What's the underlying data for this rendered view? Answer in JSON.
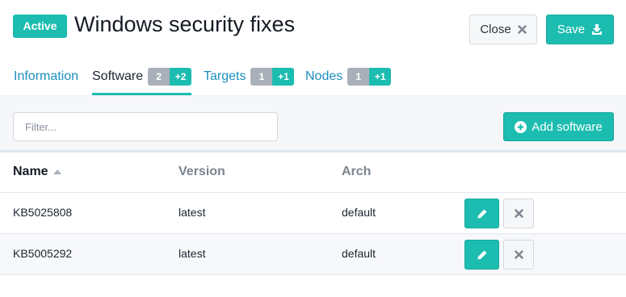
{
  "header": {
    "status_badge": "Active",
    "title": "Windows security fixes",
    "close_label": "Close",
    "save_label": "Save"
  },
  "tabs": [
    {
      "label": "Information",
      "active": false
    },
    {
      "label": "Software",
      "count": "2",
      "added": "+2",
      "active": true
    },
    {
      "label": "Targets",
      "count": "1",
      "added": "+1",
      "active": false
    },
    {
      "label": "Nodes",
      "count": "1",
      "added": "+1",
      "active": false
    }
  ],
  "toolbar": {
    "filter_placeholder": "Filter...",
    "filter_value": "",
    "add_label": "Add software"
  },
  "table": {
    "columns": [
      "Name",
      "Version",
      "Arch"
    ],
    "sort": {
      "column": "Name",
      "direction": "ascending"
    },
    "rows": [
      {
        "name": "KB5025808",
        "version": "latest",
        "arch": "default"
      },
      {
        "name": "KB5005292",
        "version": "latest",
        "arch": "default"
      }
    ]
  },
  "colors": {
    "accent": "#1cbdb0",
    "link": "#1a8fbf",
    "counter_gray": "#a9b0b9"
  },
  "icons": {
    "close": "times-icon",
    "save": "download-icon",
    "add": "plus-circle-icon",
    "edit": "pencil-icon",
    "remove": "times-icon",
    "sort": "sort-up-icon"
  }
}
